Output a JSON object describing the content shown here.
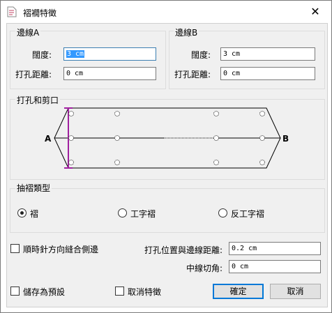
{
  "window": {
    "title": "褶襉特徵",
    "close_glyph": "✕"
  },
  "edge_a": {
    "title": "邊線A",
    "width_label": "闊度:",
    "width_value": "3 cm",
    "hole_label": "打孔距離:",
    "hole_value": "0 cm"
  },
  "edge_b": {
    "title": "邊線B",
    "width_label": "闊度:",
    "width_value": "3 cm",
    "hole_label": "打孔距離:",
    "hole_value": "0 cm"
  },
  "diagram": {
    "title": "打孔和剪口",
    "label_a": "A",
    "label_b": "B"
  },
  "pleat_type": {
    "title": "抽褶類型",
    "options": [
      {
        "label": "褶",
        "selected": true
      },
      {
        "label": "工字褶",
        "selected": false
      },
      {
        "label": "反工字褶",
        "selected": false
      }
    ]
  },
  "clockwise_label": "順時針方向縫合側邊",
  "hole_position_label": "打孔位置與邊線距離:",
  "hole_position_value": "0.2 cm",
  "center_notch_label": "中線切角:",
  "center_notch_value": "0 cm",
  "save_default_label": "儲存為預設",
  "cancel_feature_label": "取消特徵",
  "ok_label": "確定",
  "cancel_label": "取消",
  "colors": {
    "accent": "#0078d7",
    "marker": "#a020a0",
    "selection": "#3399ff"
  }
}
